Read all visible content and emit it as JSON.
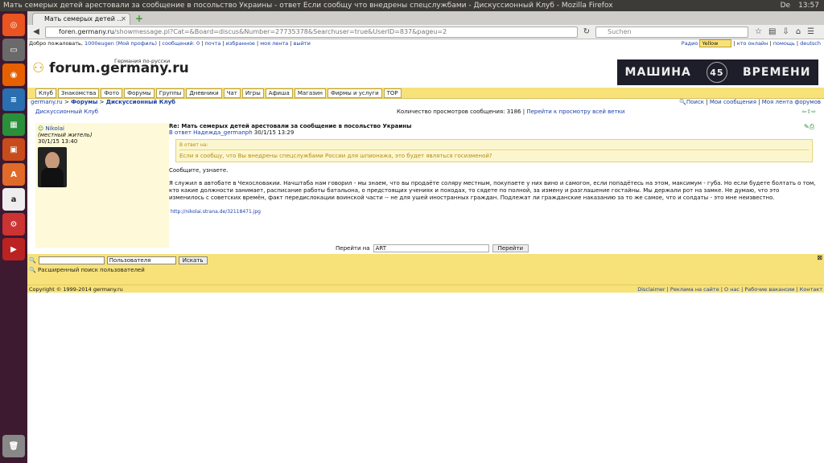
{
  "titlebar": {
    "title": "Мать семерых детей арестовали за сообщение в посольство Украины - ответ Если сообщу что внедрены спецслужбами - Дискуссионный Клуб - Mozilla Firefox",
    "time": "13:57",
    "lang": "De"
  },
  "browser": {
    "tab_title": "Мать семерых детей ...",
    "url_domain": "foren.germany.ru",
    "url_path": "/showmessage.pl?Cat=&Board=discus&Number=27735378&Searchuser=true&UserID=837&pageu=2",
    "search_placeholder": "Suchen"
  },
  "userbar": {
    "welcome": "Добро пожаловать,",
    "user": "1000eugen",
    "profile": "(Мой профиль)",
    "messages": "сообщений: 0",
    "mail": "почта",
    "favorites": "избранное",
    "feed": "моя лента",
    "logout": "выйти",
    "radio": "Радио",
    "theme": "Yellow",
    "online": "кто онлайн",
    "help": "помощь",
    "lang": "deutsch"
  },
  "header": {
    "logo": "forum.germany.ru",
    "tagline": "Германия по-русски",
    "banner_left": "МАШИНА",
    "banner_num": "45",
    "banner_right": "ВРЕМЕНИ"
  },
  "menu": [
    "Клуб",
    "Знакомства",
    "Фото",
    "Форумы",
    "Группы",
    "Дневники",
    "Чат",
    "Игры",
    "Афиша",
    "Магазин",
    "Фирмы и услуги",
    "TOP"
  ],
  "crumbs": {
    "site": "germany.ru",
    "forums": "Форумы",
    "section": "Дискуссионный Клуб",
    "search": "Поиск",
    "my_messages": "Мои сообщения",
    "my_feed": "Моя лента форумов"
  },
  "subrow": {
    "forum": "Дискуссионный Клуб",
    "views": "Количество просмотров сообщения: 3186",
    "all_views": "Перейти к просмотру всей ветки"
  },
  "post": {
    "author": "Nikolai",
    "status": "(местный житель)",
    "date": "30/1/15 13:40",
    "subject": "Re: Мать семерых детей арестовали за сообщение в посольство Украины",
    "reply_to": "В ответ Надежда_germanph",
    "reply_date": "30/1/15 13:29",
    "quote_label": "В ответ на:",
    "quote_text": "Если я сообщу, что Вы внедрены спецслужбами России для шпионажа, это будет являться госизменой?",
    "p1": "Сообщите, узнаете.",
    "p2": "Я служил в автобате в Чехословакии. Начштаба нам говорил - мы знаем, что вы продаёте соляру местным, покупаете у них вино и самогон, если попадётесь на этом, максимум - губа. Но если будете болтать о том, кто какие должности занимает, расписание работы батальона, о предстоящих учениях и походах, то сядете по полной, за измену и разглашение гостайны. Мы держали рот на замке. Не думаю, что это изменилось с советских времён, факт передислокации воинской части -- не для ушей иностранных граждан. Подлежат ли гражданские наказанию за то же самое, что и солдаты - это мне неизвестно.",
    "link": "http://nikolai.strana.de/32118471.jpg"
  },
  "goto": {
    "label": "Перейти на",
    "value": "ART",
    "button": "Перейти"
  },
  "search": {
    "select": "Пользователя",
    "button": "Искать",
    "advanced": "Расширенный поиск пользователей"
  },
  "footer": {
    "copyright": "Copyright © 1999-2014 germany.ru",
    "links": "Disclaimer | Реклама на сайте | О нас | Рабочие вакансии | Контакт"
  }
}
